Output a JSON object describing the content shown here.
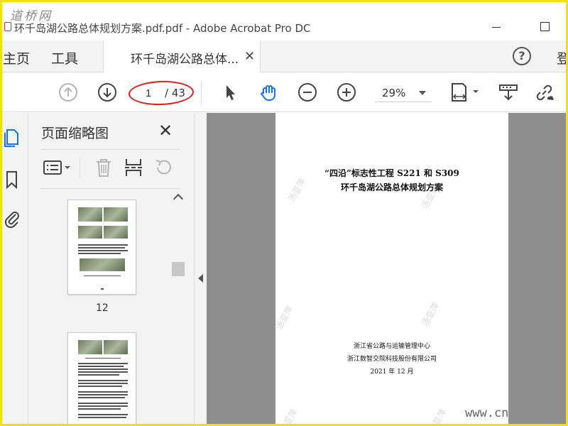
{
  "watermark_top": "道桥网",
  "window": {
    "title": "环千岛湖公路总体规划方案.pdf.pdf - Adobe Acrobat Pro DC"
  },
  "tabs": {
    "home": "主页",
    "tools": "工具",
    "document": "环千岛湖公路总体...",
    "login": "登"
  },
  "toolbar": {
    "page_current": "1",
    "page_total": "/ 43",
    "zoom": "29%"
  },
  "thumb_panel": {
    "title": "页面缩略图",
    "thumbnails": [
      {
        "label": "12"
      }
    ]
  },
  "document": {
    "title_line1": "“四沿”标志性工程 S221 和 S309",
    "title_line2": "环千岛湖公路总体规划方案",
    "org_line1": "浙江省公路与运输管理中心",
    "org_line2": "浙江数智交院科技股份有限公司",
    "date": "2021 年 12 月",
    "watermark": "汤亚萍"
  },
  "site_watermark": "www.cn",
  "colors": {
    "frame": "#f2e200",
    "accent_blue": "#1473e6",
    "annotation_red": "#e21b1b",
    "doc_background": "#8e8e8e"
  }
}
